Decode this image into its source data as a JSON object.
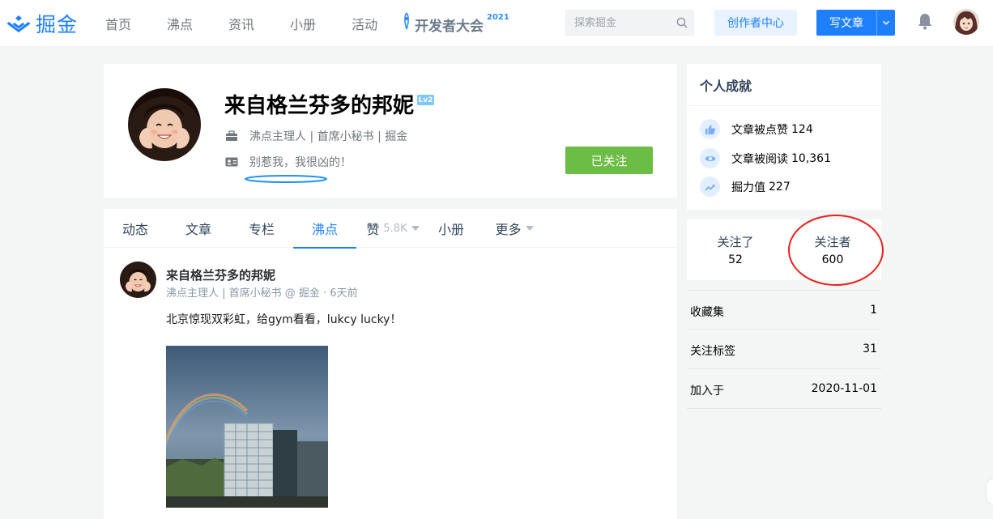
{
  "header": {
    "logo_text": "掘金",
    "nav": [
      "首页",
      "沸点",
      "资讯",
      "小册",
      "活动"
    ],
    "devcon": {
      "text": "开发者大会",
      "year": "2021"
    },
    "search_placeholder": "探索掘金",
    "creator_center": "创作者中心",
    "write_article": "写文章",
    "accent_color": "#1e80ff"
  },
  "profile": {
    "name": "来自格兰芬多的邦妮",
    "level": "Lv2",
    "title": "沸点主理人 | 首席小秘书 | 掘金",
    "bio": "别惹我，我很凶的！",
    "follow_label": "已关注",
    "follow_color": "#6cbd45"
  },
  "tabs": [
    {
      "label": "动态"
    },
    {
      "label": "文章"
    },
    {
      "label": "专栏"
    },
    {
      "label": "沸点",
      "active": true
    },
    {
      "label": "赞",
      "count": "5.8K",
      "dropdown": true
    },
    {
      "label": "小册"
    },
    {
      "label": "更多",
      "dropdown": true
    }
  ],
  "post": {
    "author": "来自格兰芬多的邦妮",
    "meta": "沸点主理人 | 首席小秘书 @ 掘金 · 6天前",
    "text": "北京惊现双彩虹，给gym看看，lukcy lucky！"
  },
  "achievements": {
    "title": "个人成就",
    "items": [
      {
        "icon": "thumbs-up-icon",
        "label": "文章被点赞",
        "value": "124"
      },
      {
        "icon": "eye-icon",
        "label": "文章被阅读",
        "value": "10,361"
      },
      {
        "icon": "trend-up-icon",
        "label": "掘力值",
        "value": "227"
      }
    ]
  },
  "follow_stats": {
    "following_label": "关注了",
    "following_value": "52",
    "followers_label": "关注者",
    "followers_value": "600"
  },
  "stats": [
    {
      "label": "收藏集",
      "value": "1"
    },
    {
      "label": "关注标签",
      "value": "31"
    },
    {
      "label": "加入于",
      "value": "2020-11-01"
    }
  ]
}
